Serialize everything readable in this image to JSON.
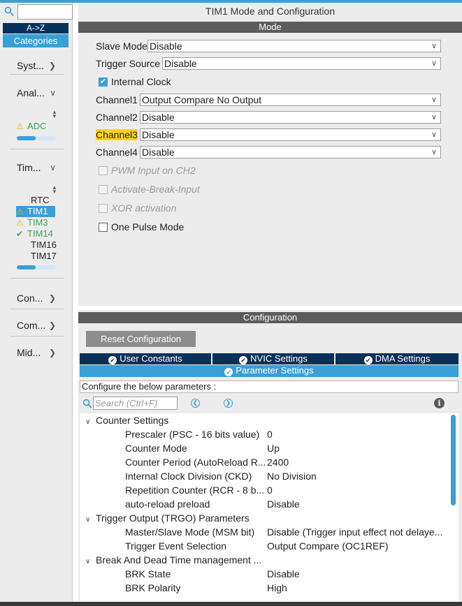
{
  "sidebar": {
    "search_value": "",
    "az_label": "A->Z",
    "categories_label": "Categories",
    "cat_system": "Syst...",
    "cat_analog": "Anal...",
    "adc_label": "ADC",
    "cat_timers": "Tim...",
    "timers": [
      "RTC",
      "TIM1",
      "TIM3",
      "TIM14",
      "TIM16",
      "TIM17"
    ],
    "cat_connectivity": "Con...",
    "cat_computing": "Com...",
    "cat_middleware": "Mid..."
  },
  "mode": {
    "title": "TIM1 Mode and Configuration",
    "header": "Mode",
    "slave_mode_label": "Slave Mode",
    "slave_mode_value": "Disable",
    "trigger_source_label": "Trigger Source",
    "trigger_source_value": "Disable",
    "internal_clock_label": "Internal Clock",
    "channel1_label": "Channel1",
    "channel1_value": "Output Compare No Output",
    "channel2_label": "Channel2",
    "channel2_value": "Disable",
    "channel3_label": "Channel3",
    "channel3_value": "Disable",
    "channel4_label": "Channel4",
    "channel4_value": "Disable",
    "pwm_input_label": "PWM Input on CH2",
    "activate_break_label": "Activate-Break-Input",
    "xor_label": "XOR activation",
    "one_pulse_label": "One Pulse Mode"
  },
  "config": {
    "header": "Configuration",
    "reset_label": "Reset Configuration",
    "tab_user_constants": "User Constants",
    "tab_nvic": "NVIC Settings",
    "tab_dma": "DMA Settings",
    "tab_params": "Parameter Settings",
    "configure_label": "Configure the below parameters :",
    "search_placeholder": "Search (Ctrl+F)"
  },
  "tree": {
    "counter_settings": "Counter Settings",
    "prescaler_name": "Prescaler (PSC - 16 bits value)",
    "prescaler_value": "0",
    "counter_mode_name": "Counter Mode",
    "counter_mode_value": "Up",
    "counter_period_name": "Counter Period (AutoReload R...",
    "counter_period_value": "2400",
    "clock_division_name": "Internal Clock Division (CKD)",
    "clock_division_value": "No Division",
    "repetition_name": "Repetition Counter (RCR - 8 b...",
    "repetition_value": "0",
    "autoreload_name": "auto-reload preload",
    "autoreload_value": "Disable",
    "trgo_group": "Trigger Output (TRGO) Parameters",
    "msm_name": "Master/Slave Mode (MSM bit)",
    "msm_value": "Disable (Trigger input effect not delaye...",
    "trigger_event_name": "Trigger Event Selection",
    "trigger_event_value": "Output Compare (OC1REF)",
    "break_group": "Break And Dead Time management ...",
    "brk_state_name": "BRK State",
    "brk_state_value": "Disable",
    "brk_polarity_name": "BRK Polarity",
    "brk_polarity_value": "High"
  }
}
